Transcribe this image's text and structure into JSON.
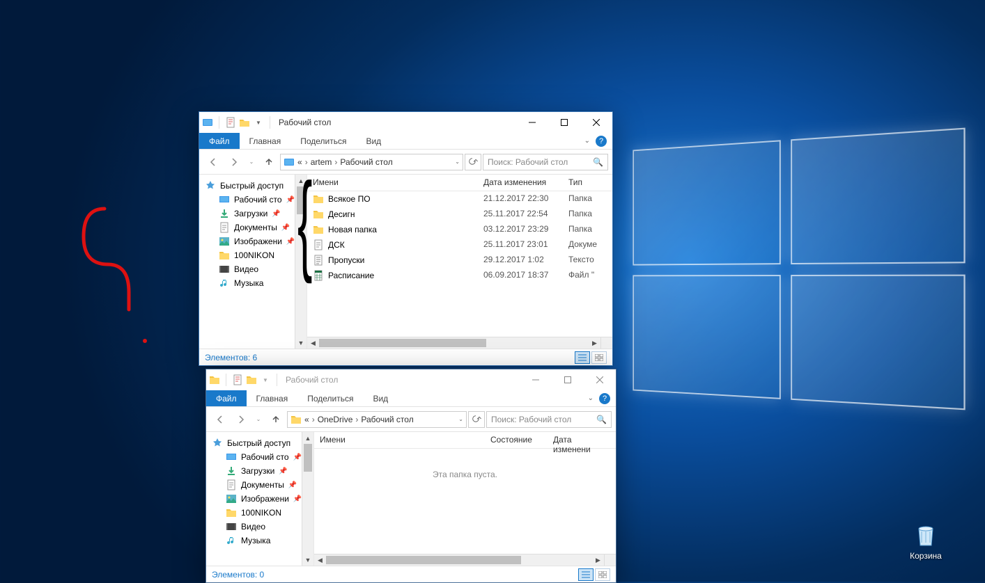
{
  "desktop": {
    "recycle_bin_label": "Корзина"
  },
  "window1": {
    "title": "Рабочий стол",
    "tabs": {
      "file": "Файл",
      "home": "Главная",
      "share": "Поделиться",
      "view": "Вид"
    },
    "breadcrumbs": [
      "«",
      "artem",
      "Рабочий стол"
    ],
    "search_placeholder": "Поиск: Рабочий стол",
    "sidebar": {
      "quick_access": "Быстрый доступ",
      "items": [
        {
          "label": "Рабочий сто",
          "icon": "desktop"
        },
        {
          "label": "Загрузки",
          "icon": "download"
        },
        {
          "label": "Документы",
          "icon": "document"
        },
        {
          "label": "Изображени",
          "icon": "picture"
        },
        {
          "label": "100NIKON",
          "icon": "folder"
        },
        {
          "label": "Видео",
          "icon": "video"
        },
        {
          "label": "Музыка",
          "icon": "music"
        }
      ]
    },
    "columns": {
      "name": "Имени",
      "date": "Дата изменения",
      "type": "Тип"
    },
    "files": [
      {
        "name": "Всякое ПО",
        "date": "21.12.2017 22:30",
        "type": "Папка",
        "icon": "folder"
      },
      {
        "name": "Десигн",
        "date": "25.11.2017 22:54",
        "type": "Папка",
        "icon": "folder"
      },
      {
        "name": "Новая папка",
        "date": "03.12.2017 23:29",
        "type": "Папка",
        "icon": "folder"
      },
      {
        "name": "ДСК",
        "date": "25.11.2017 23:01",
        "type": "Докуме",
        "icon": "doc"
      },
      {
        "name": "Пропуски",
        "date": "29.12.2017 1:02",
        "type": "Тексто",
        "icon": "txt"
      },
      {
        "name": "Расписание",
        "date": "06.09.2017 18:37",
        "type": "Файл \"",
        "icon": "xls"
      }
    ],
    "status": "Элементов: 6"
  },
  "window2": {
    "title": "Рабочий стол",
    "tabs": {
      "file": "Файл",
      "home": "Главная",
      "share": "Поделиться",
      "view": "Вид"
    },
    "breadcrumbs": [
      "«",
      "OneDrive",
      "Рабочий стол"
    ],
    "search_placeholder": "Поиск: Рабочий стол",
    "sidebar": {
      "quick_access": "Быстрый доступ",
      "items": [
        {
          "label": "Рабочий сто",
          "icon": "desktop"
        },
        {
          "label": "Загрузки",
          "icon": "download"
        },
        {
          "label": "Документы",
          "icon": "document"
        },
        {
          "label": "Изображени",
          "icon": "picture"
        },
        {
          "label": "100NIKON",
          "icon": "folder"
        },
        {
          "label": "Видео",
          "icon": "video"
        },
        {
          "label": "Музыка",
          "icon": "music"
        }
      ]
    },
    "columns": {
      "name": "Имени",
      "state": "Состояние",
      "date": "Дата изменени"
    },
    "empty_message": "Эта папка пуста.",
    "status": "Элементов: 0"
  }
}
